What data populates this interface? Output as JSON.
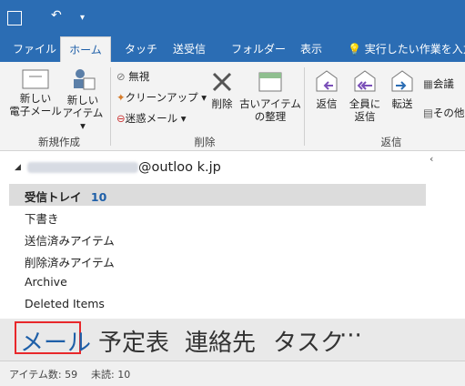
{
  "quick_access": {
    "undo_icon": "undo-icon",
    "customize_icon": "customize-qat-icon"
  },
  "tabs": [
    {
      "label": "ファイル"
    },
    {
      "label": "ホーム"
    },
    {
      "label": "タッチ"
    },
    {
      "label": "送受信"
    },
    {
      "label": "フォルダー"
    },
    {
      "label": "表示"
    },
    {
      "label": "実行したい作業を入力"
    }
  ],
  "ribbon": {
    "new_group": {
      "label": "新規作成",
      "new_mail": [
        "新しい",
        "電子メール"
      ],
      "new_item": [
        "新しい",
        "アイテム"
      ]
    },
    "delete_group": {
      "label": "削除",
      "ignore": "無視",
      "cleanup": "クリーンアップ",
      "junk": "迷惑メール",
      "delete": "削除",
      "archive": [
        "古いアイテム",
        "の整理"
      ]
    },
    "respond_group": {
      "label": "返信",
      "reply": "返信",
      "reply_all": [
        "全員に",
        "返信"
      ],
      "forward": "転送",
      "meeting": "会議",
      "more": "その他"
    }
  },
  "folders": {
    "account": "@outloo k.jp",
    "items": [
      {
        "label": "受信トレイ",
        "count": "10"
      },
      {
        "label": "下書き"
      },
      {
        "label": "送信済みアイテム"
      },
      {
        "label": "削除済みアイテム"
      },
      {
        "label": "Archive"
      },
      {
        "label": "Deleted Items"
      }
    ]
  },
  "nav": {
    "mail": "メール",
    "calendar": "予定表",
    "people": "連絡先",
    "tasks": "タスク",
    "more": "···"
  },
  "status": {
    "items": "アイテム数: 59",
    "unread": "未読: 10"
  },
  "colors": {
    "ribbon_blue": "#2b6db4",
    "highlight": "#e8282b"
  }
}
